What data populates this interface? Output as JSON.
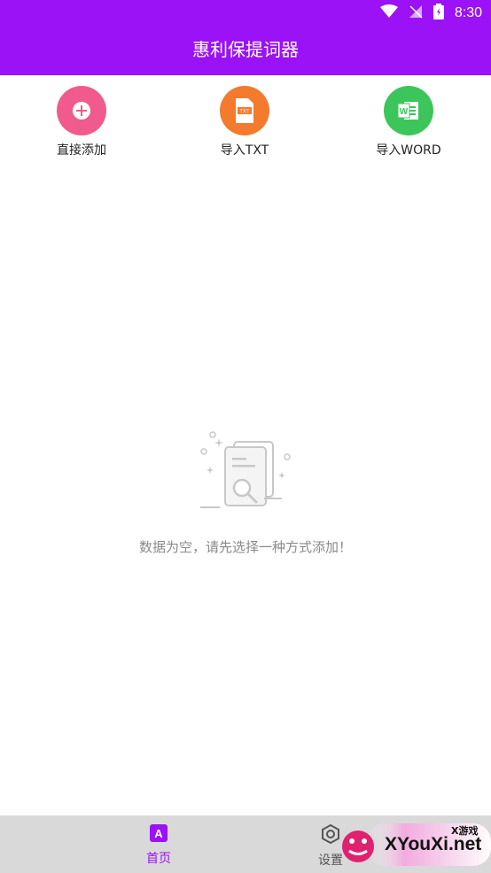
{
  "status_bar": {
    "time": "8:30"
  },
  "header": {
    "title": "惠利保提词器"
  },
  "actions": [
    {
      "label": "直接添加",
      "icon": "plus-icon",
      "color": "#f05a8d"
    },
    {
      "label": "导入TXT",
      "icon": "txt-file-icon",
      "color": "#f47a2e"
    },
    {
      "label": "导入WORD",
      "icon": "word-file-icon",
      "color": "#3cc55a"
    }
  ],
  "empty_state": {
    "icon": "document-search-icon",
    "text": "数据为空，请先选择一种方式添加！"
  },
  "bottom_nav": {
    "tabs": [
      {
        "label": "首页",
        "active": true,
        "color": "#9a12f5"
      },
      {
        "label": "设置",
        "active": false,
        "color": "#555555"
      }
    ]
  },
  "watermark": {
    "text": "XYouXi.net",
    "small": "X游戏"
  },
  "colors": {
    "primary": "#9a12f5"
  }
}
